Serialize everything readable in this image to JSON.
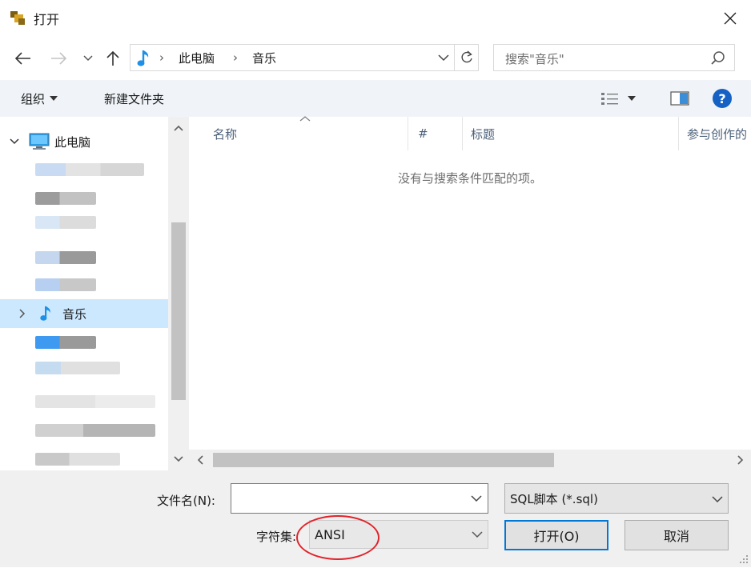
{
  "window": {
    "title": "打开"
  },
  "address": {
    "segments": [
      "此电脑",
      "音乐"
    ]
  },
  "search": {
    "placeholder": "搜索\"音乐\""
  },
  "toolbar": {
    "organize_label": "组织",
    "new_folder_label": "新建文件夹"
  },
  "nav": {
    "pc_label": "此电脑",
    "music_label": "音乐"
  },
  "file_list": {
    "columns": [
      "名称",
      "#",
      "标题",
      "参与创作的"
    ],
    "empty_message": "没有与搜索条件匹配的项。"
  },
  "bottom": {
    "filename_label": "文件名(N):",
    "filename_value": "",
    "filetype_value": "SQL脚本 (*.sql)",
    "charset_label": "字符集:",
    "charset_value": "ANSI",
    "open_label": "打开(O)",
    "cancel_label": "取消"
  },
  "colors": {
    "accent": "#0078d7",
    "selection": "#cce8ff",
    "highlight_circle": "#e0232b",
    "music_icon": "#1e90e6"
  },
  "icons": [
    "app-icon",
    "close-icon",
    "back-icon",
    "forward-icon",
    "recent-locations-icon",
    "up-icon",
    "music-icon",
    "refresh-icon",
    "search-icon",
    "view-options-icon",
    "preview-pane-icon",
    "help-icon",
    "computer-icon",
    "chevron-icon"
  ]
}
